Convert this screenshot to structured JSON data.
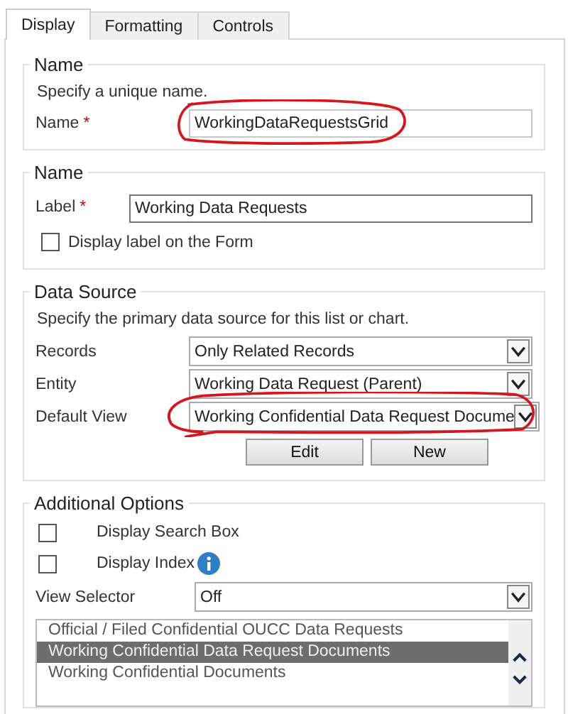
{
  "tabs": [
    {
      "label": "Display",
      "selected": true
    },
    {
      "label": "Formatting",
      "selected": false
    },
    {
      "label": "Controls",
      "selected": false
    }
  ],
  "name_section": {
    "title": "Name",
    "hint": "Specify a unique name.",
    "field": {
      "label": "Name",
      "required_mark": "*",
      "value": "WorkingDataRequestsGrid",
      "circled": true
    }
  },
  "label_section": {
    "title": "Name",
    "field": {
      "label": "Label",
      "required_mark": "*",
      "value": "Working Data Requests"
    },
    "checkbox": {
      "label": "Display label on the Form",
      "checked": false
    }
  },
  "data_source": {
    "title": "Data Source",
    "hint": "Specify the primary data source for this list or chart.",
    "selects": [
      {
        "label": "Records",
        "value": "Only Related Records",
        "circled": false
      },
      {
        "label": "Entity",
        "value": "Working Data Request (Parent)",
        "circled": false
      },
      {
        "label": "Default View",
        "value": "Working Confidential Data Request Docume",
        "circled": true
      }
    ],
    "buttons": [
      "Edit",
      "New"
    ]
  },
  "additional_options": {
    "title": "Additional Options",
    "checkboxes": [
      {
        "label": "Display Search Box",
        "checked": false,
        "info": false
      },
      {
        "label": "Display Index",
        "checked": false,
        "info": true
      }
    ],
    "view_selector": {
      "label": "View Selector",
      "value": "Off"
    },
    "views": [
      {
        "label": "Official / Filed Confidential OUCC Data Requests",
        "selected": false
      },
      {
        "label": "Working Confidential Data Request Documents",
        "selected": true
      },
      {
        "label": "Working Confidential Documents",
        "selected": false
      }
    ]
  }
}
